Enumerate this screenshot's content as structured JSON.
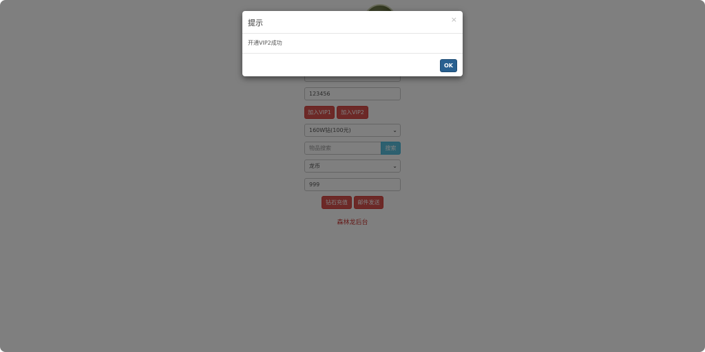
{
  "form": {
    "password_value": "123456",
    "vip1_button": "加入VIP1",
    "vip2_button": "加入VIP2",
    "recharge_select": "160W钻(100元)",
    "item_search_placeholder": "物品搜索",
    "search_button": "搜索",
    "item_select": "龙币",
    "quantity_value": "999",
    "diamond_recharge_button": "钻石充值",
    "mail_send_button": "邮件发送",
    "footer_link": "森林龙后台"
  },
  "modal": {
    "title": "提示",
    "close_symbol": "×",
    "message": "开通VIP2成功",
    "ok_button": "OK"
  },
  "colors": {
    "overlay": "rgba(0,0,0,0.5)",
    "danger": "#d9534f",
    "info": "#5bc0de",
    "primary": "#286090"
  }
}
